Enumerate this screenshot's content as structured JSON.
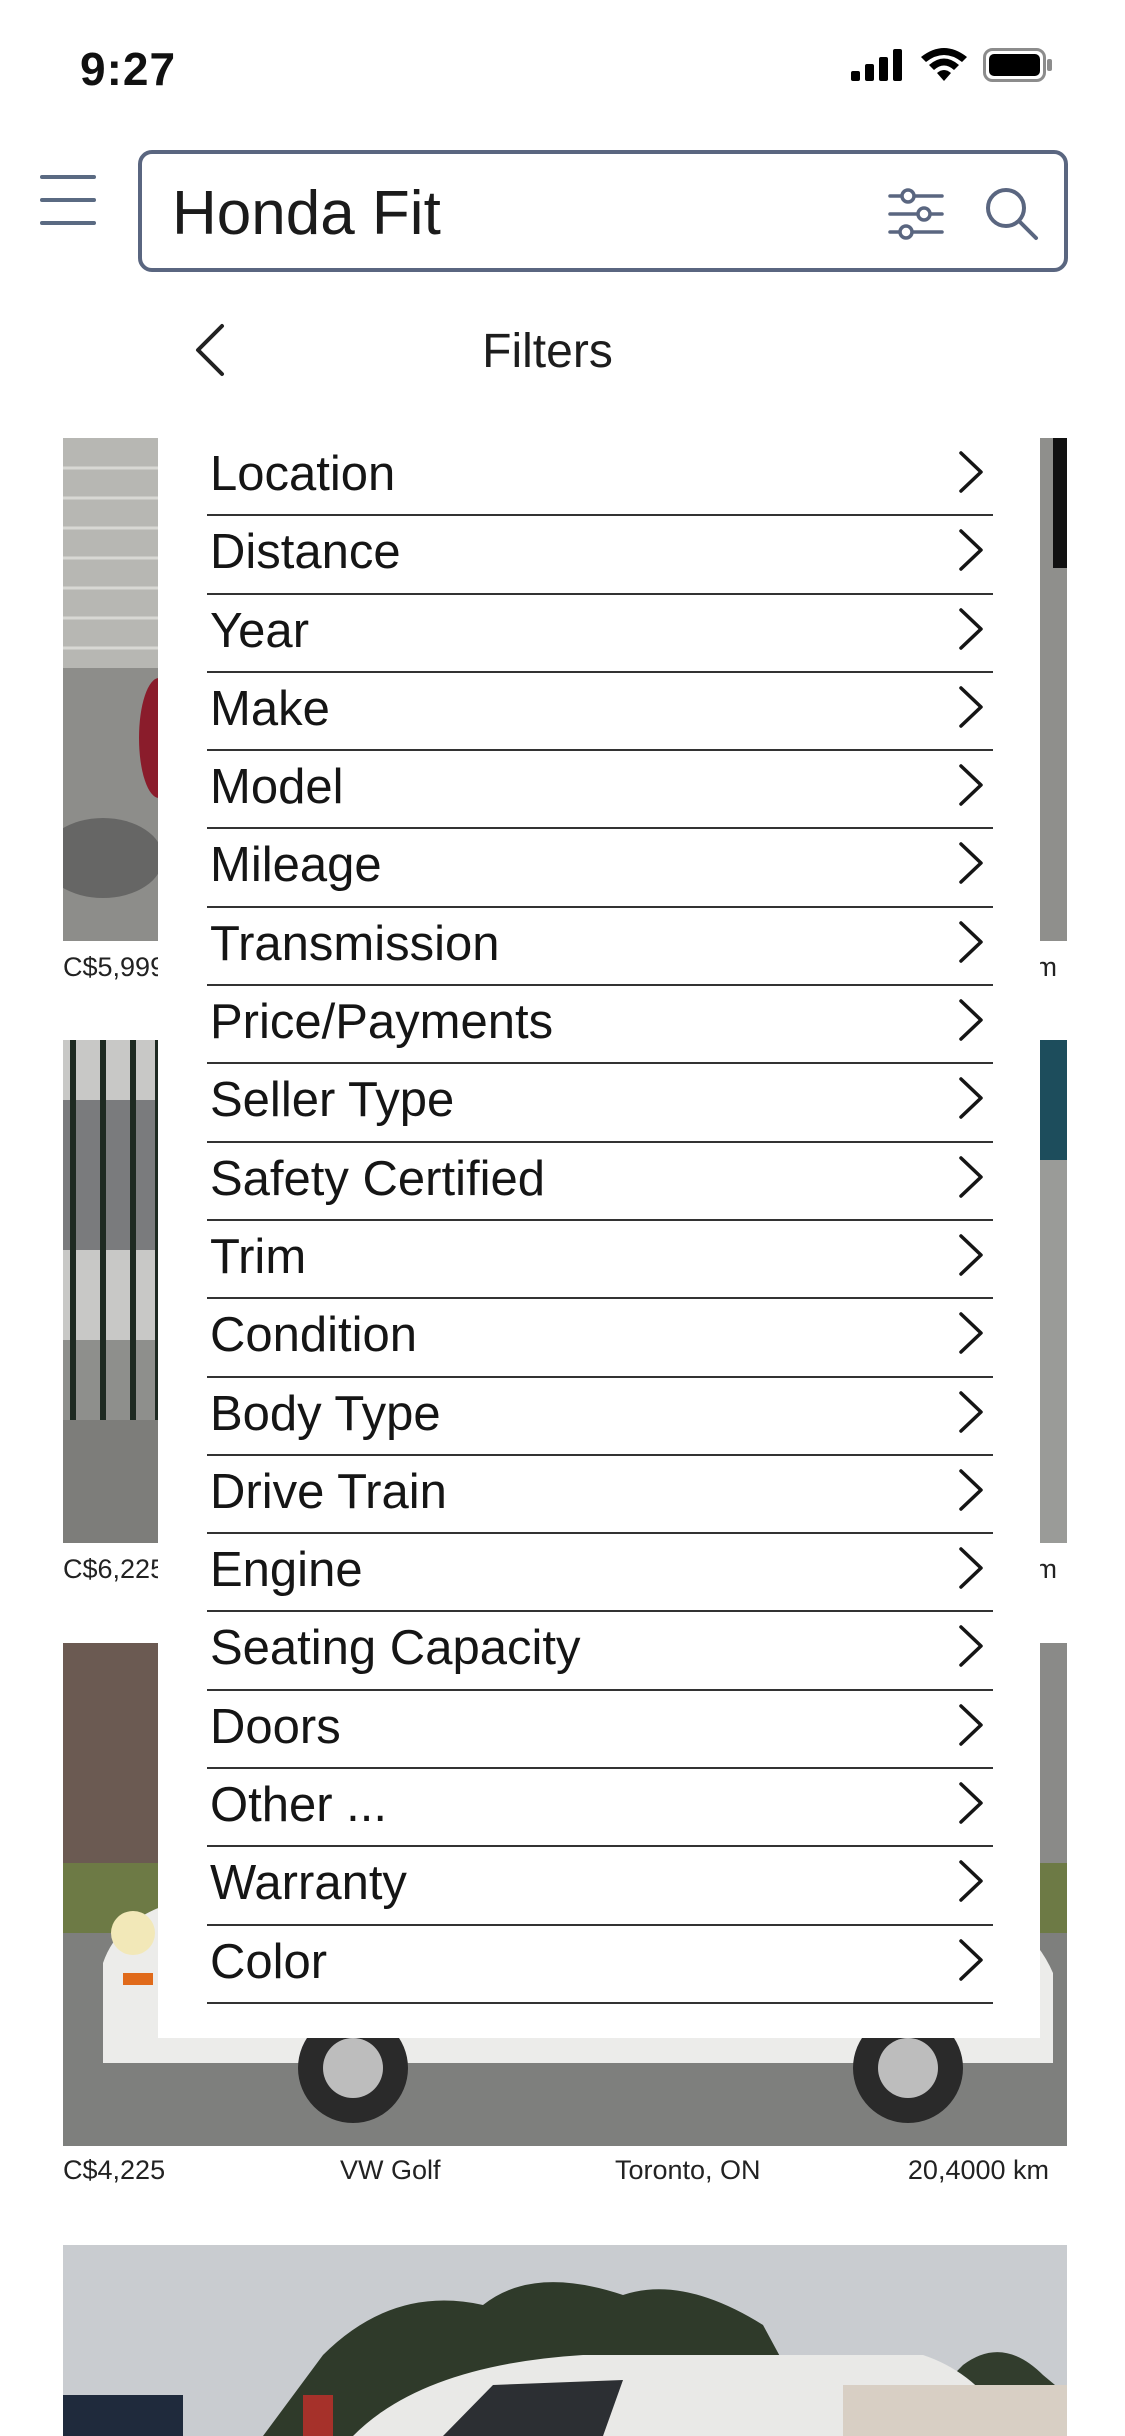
{
  "status_bar": {
    "time": "9:27"
  },
  "search": {
    "query": "Honda Fit"
  },
  "filters": {
    "title": "Filters",
    "items": [
      "Location",
      "Distance",
      "Year",
      "Make",
      "Model",
      "Mileage",
      "Transmission",
      "Price/Payments",
      "Seller Type",
      "Safety Certified",
      "Trim",
      "Condition",
      "Body Type",
      "Drive Train",
      "Engine",
      "Seating Capacity",
      "Doors",
      "Other ...",
      "Warranty",
      "Color"
    ]
  },
  "listings": [
    {
      "price": "C$5,999",
      "model": "",
      "location": "",
      "mileage": "m"
    },
    {
      "price": "C$6,225",
      "model": "",
      "location": "",
      "mileage": "m"
    },
    {
      "price": "C$4,225",
      "model": "VW Golf",
      "location": "Toronto, ON",
      "mileage": "20,4000 km"
    }
  ],
  "colors": {
    "accent": "#5a6680",
    "divider": "#333333"
  }
}
